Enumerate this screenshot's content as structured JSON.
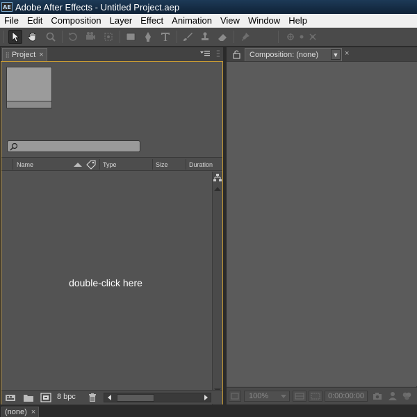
{
  "window": {
    "title": "Adobe After Effects - Untitled Project.aep",
    "logo_text": "AE"
  },
  "menu": [
    "File",
    "Edit",
    "Composition",
    "Layer",
    "Effect",
    "Animation",
    "View",
    "Window",
    "Help"
  ],
  "project_panel": {
    "tab_label": "Project",
    "close_glyph": "×",
    "columns": {
      "name": "Name",
      "type": "Type",
      "size": "Size",
      "duration": "Duration"
    },
    "hint": "double-click here",
    "bit_depth": "8 bpc"
  },
  "composition_panel": {
    "tab_label": "Composition: (none)",
    "dropdown_glyph": "▼",
    "close_glyph": "×",
    "zoom": "100%",
    "timecode": "0:00:00:00"
  },
  "timeline": {
    "tab_label": "(none)",
    "close_glyph": "×"
  },
  "colors": {
    "panel_bg": "#535353",
    "active_panel_border": "#c89b33",
    "titlebar": "#0f2237"
  }
}
